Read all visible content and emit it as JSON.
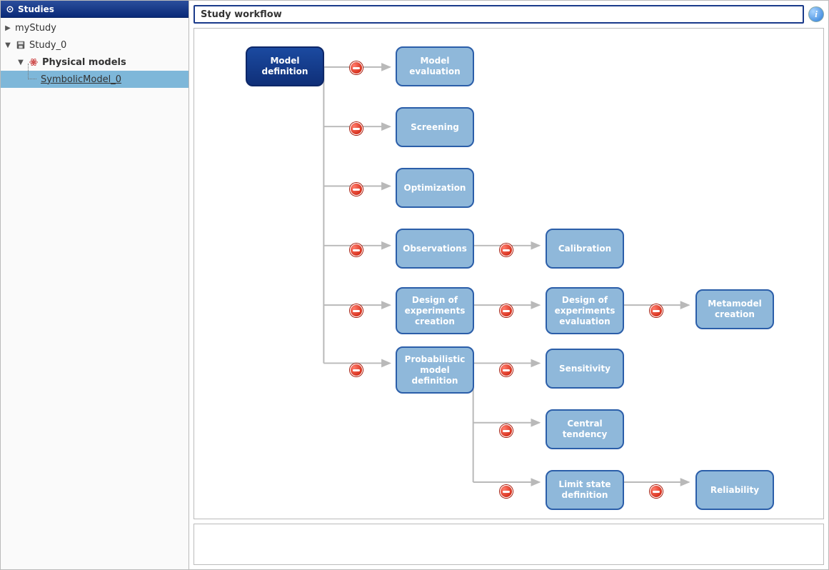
{
  "sidebar": {
    "title": "Studies",
    "items": {
      "myStudy": {
        "label": "myStudy"
      },
      "study0": {
        "label": "Study_0"
      },
      "physicalModels": {
        "label": "Physical models"
      },
      "symbolicModel": {
        "label": "SymbolicModel_0"
      }
    }
  },
  "header": {
    "title": "Study workflow",
    "info_tooltip": "i"
  },
  "workflow": {
    "model_definition": "Model definition",
    "model_evaluation": "Model evaluation",
    "screening": "Screening",
    "optimization": "Optimization",
    "observations": "Observations",
    "calibration": "Calibration",
    "doe_creation": "Design of experiments creation",
    "doe_evaluation": "Design of experiments evaluation",
    "metamodel_creation": "Metamodel creation",
    "prob_model_def": "Probabilistic model definition",
    "sensitivity": "Sensitivity",
    "central_tendency": "Central tendency",
    "limit_state_def": "Limit state definition",
    "reliability": "Reliability"
  }
}
